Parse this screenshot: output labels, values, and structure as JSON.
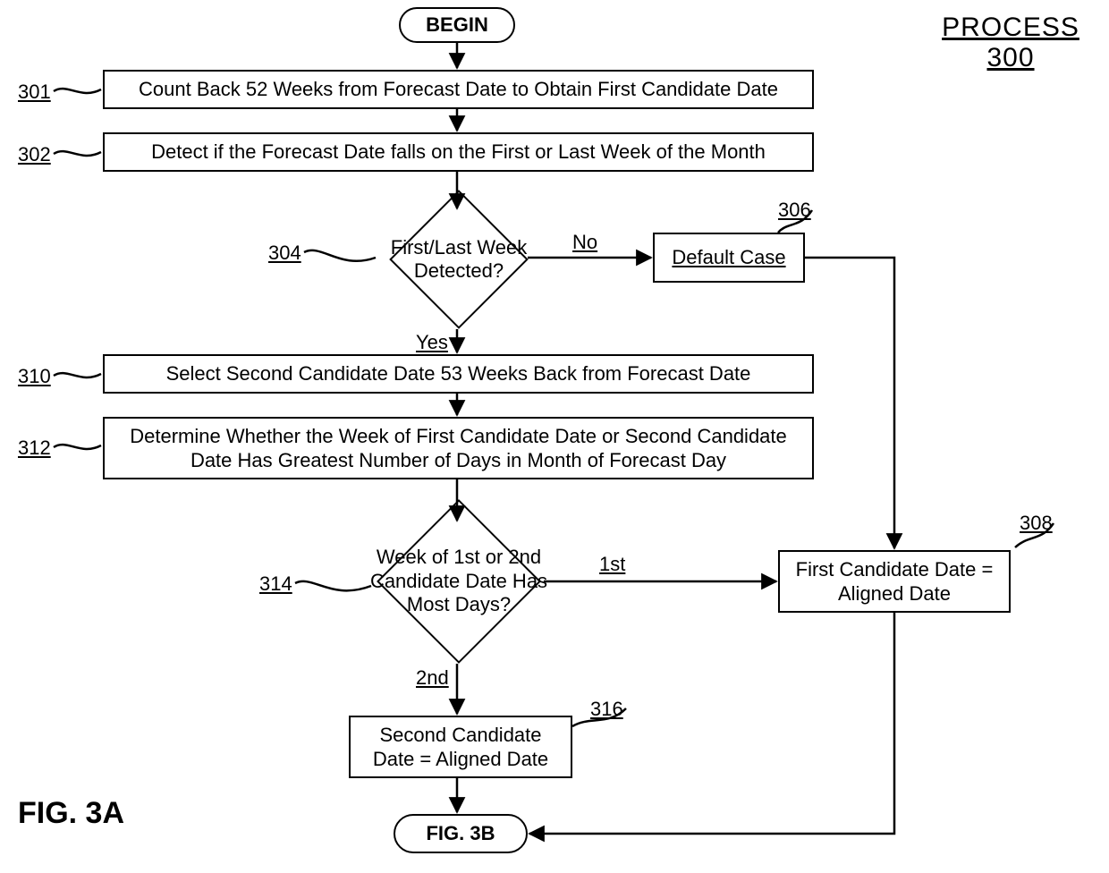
{
  "header": {
    "process_label": "PROCESS",
    "process_number": "300"
  },
  "figure_label": "FIG. 3A",
  "terminators": {
    "begin": "BEGIN",
    "end": "FIG. 3B"
  },
  "steps": {
    "s301": {
      "ref": "301",
      "text": "Count Back 52 Weeks from Forecast Date to Obtain First Candidate Date"
    },
    "s302": {
      "ref": "302",
      "text": "Detect if the Forecast Date falls on the First or Last Week of the Month"
    },
    "s304": {
      "ref": "304",
      "text": "First/Last Week Detected?",
      "yes": "Yes",
      "no": "No"
    },
    "s306": {
      "ref": "306",
      "text": "Default Case"
    },
    "s308": {
      "ref": "308",
      "text": "First Candidate Date = Aligned Date"
    },
    "s310": {
      "ref": "310",
      "text": "Select Second Candidate Date 53 Weeks Back from Forecast Date"
    },
    "s312": {
      "ref": "312",
      "text": "Determine Whether the Week of First Candidate Date or Second Candidate Date Has Greatest Number of Days in Month of Forecast Day"
    },
    "s314": {
      "ref": "314",
      "text": "Week of 1st or 2nd Candidate Date Has Most Days?",
      "first": "1st",
      "second": "2nd"
    },
    "s316": {
      "ref": "316",
      "text": "Second Candidate Date = Aligned Date"
    }
  }
}
